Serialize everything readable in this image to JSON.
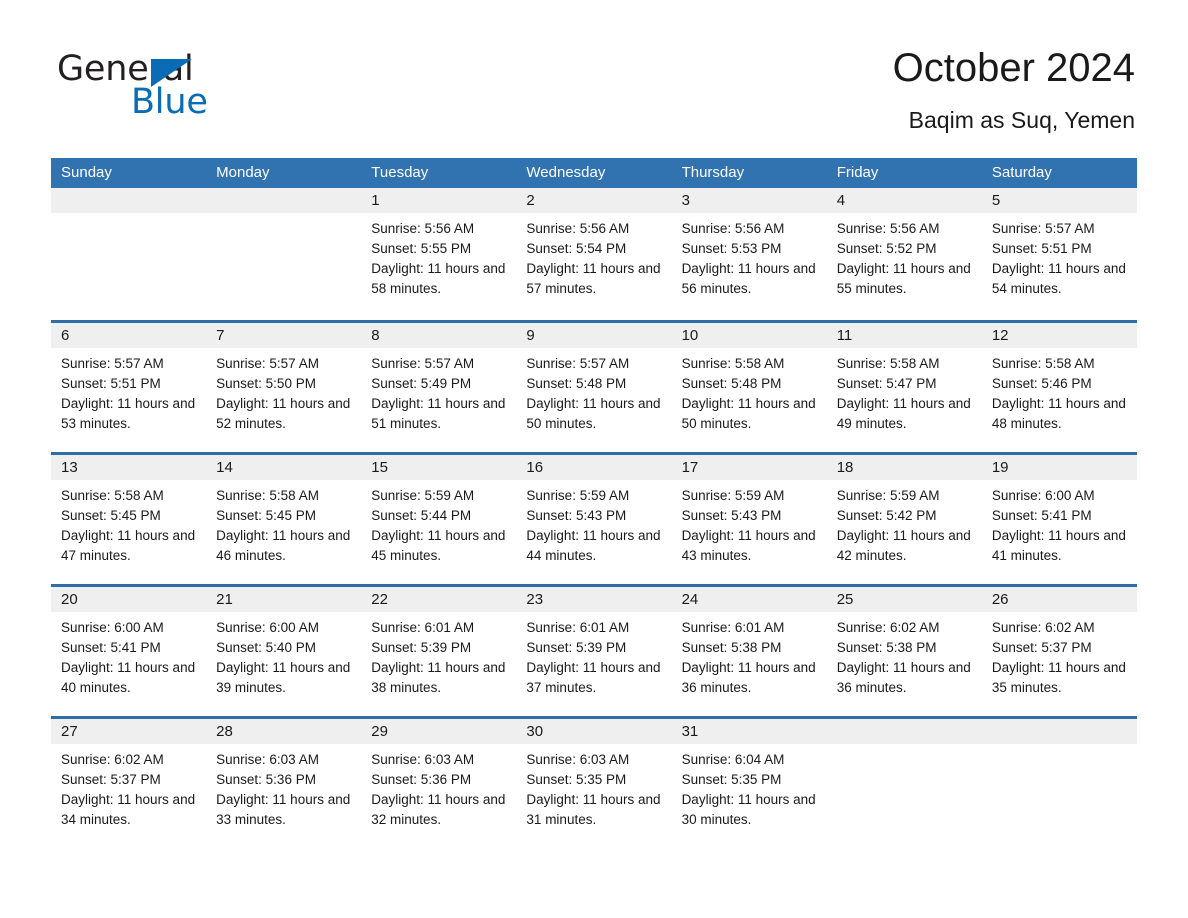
{
  "brand": {
    "word_one": "General",
    "word_two": "Blue",
    "triangle_color": "#0a6cb4",
    "text_color": "#231f20"
  },
  "header": {
    "title": "October 2024",
    "subtitle": "Baqim as Suq, Yemen"
  },
  "theme": {
    "header_blue": "#3172b0",
    "rule_blue": "#2e6da8",
    "date_band": "#efefef",
    "text": "#1a1a1a"
  },
  "weekdays": [
    "Sunday",
    "Monday",
    "Tuesday",
    "Wednesday",
    "Thursday",
    "Friday",
    "Saturday"
  ],
  "weeks": [
    [
      {
        "day": "",
        "sunrise": "",
        "sunset": "",
        "daylight": "",
        "empty": true
      },
      {
        "day": "",
        "sunrise": "",
        "sunset": "",
        "daylight": "",
        "empty": true
      },
      {
        "day": "1",
        "sunrise": "Sunrise: 5:56 AM",
        "sunset": "Sunset: 5:55 PM",
        "daylight": "Daylight: 11 hours and 58 minutes."
      },
      {
        "day": "2",
        "sunrise": "Sunrise: 5:56 AM",
        "sunset": "Sunset: 5:54 PM",
        "daylight": "Daylight: 11 hours and 57 minutes."
      },
      {
        "day": "3",
        "sunrise": "Sunrise: 5:56 AM",
        "sunset": "Sunset: 5:53 PM",
        "daylight": "Daylight: 11 hours and 56 minutes."
      },
      {
        "day": "4",
        "sunrise": "Sunrise: 5:56 AM",
        "sunset": "Sunset: 5:52 PM",
        "daylight": "Daylight: 11 hours and 55 minutes."
      },
      {
        "day": "5",
        "sunrise": "Sunrise: 5:57 AM",
        "sunset": "Sunset: 5:51 PM",
        "daylight": "Daylight: 11 hours and 54 minutes."
      }
    ],
    [
      {
        "day": "6",
        "sunrise": "Sunrise: 5:57 AM",
        "sunset": "Sunset: 5:51 PM",
        "daylight": "Daylight: 11 hours and 53 minutes."
      },
      {
        "day": "7",
        "sunrise": "Sunrise: 5:57 AM",
        "sunset": "Sunset: 5:50 PM",
        "daylight": "Daylight: 11 hours and 52 minutes."
      },
      {
        "day": "8",
        "sunrise": "Sunrise: 5:57 AM",
        "sunset": "Sunset: 5:49 PM",
        "daylight": "Daylight: 11 hours and 51 minutes."
      },
      {
        "day": "9",
        "sunrise": "Sunrise: 5:57 AM",
        "sunset": "Sunset: 5:48 PM",
        "daylight": "Daylight: 11 hours and 50 minutes."
      },
      {
        "day": "10",
        "sunrise": "Sunrise: 5:58 AM",
        "sunset": "Sunset: 5:48 PM",
        "daylight": "Daylight: 11 hours and 50 minutes."
      },
      {
        "day": "11",
        "sunrise": "Sunrise: 5:58 AM",
        "sunset": "Sunset: 5:47 PM",
        "daylight": "Daylight: 11 hours and 49 minutes."
      },
      {
        "day": "12",
        "sunrise": "Sunrise: 5:58 AM",
        "sunset": "Sunset: 5:46 PM",
        "daylight": "Daylight: 11 hours and 48 minutes."
      }
    ],
    [
      {
        "day": "13",
        "sunrise": "Sunrise: 5:58 AM",
        "sunset": "Sunset: 5:45 PM",
        "daylight": "Daylight: 11 hours and 47 minutes."
      },
      {
        "day": "14",
        "sunrise": "Sunrise: 5:58 AM",
        "sunset": "Sunset: 5:45 PM",
        "daylight": "Daylight: 11 hours and 46 minutes."
      },
      {
        "day": "15",
        "sunrise": "Sunrise: 5:59 AM",
        "sunset": "Sunset: 5:44 PM",
        "daylight": "Daylight: 11 hours and 45 minutes."
      },
      {
        "day": "16",
        "sunrise": "Sunrise: 5:59 AM",
        "sunset": "Sunset: 5:43 PM",
        "daylight": "Daylight: 11 hours and 44 minutes."
      },
      {
        "day": "17",
        "sunrise": "Sunrise: 5:59 AM",
        "sunset": "Sunset: 5:43 PM",
        "daylight": "Daylight: 11 hours and 43 minutes."
      },
      {
        "day": "18",
        "sunrise": "Sunrise: 5:59 AM",
        "sunset": "Sunset: 5:42 PM",
        "daylight": "Daylight: 11 hours and 42 minutes."
      },
      {
        "day": "19",
        "sunrise": "Sunrise: 6:00 AM",
        "sunset": "Sunset: 5:41 PM",
        "daylight": "Daylight: 11 hours and 41 minutes."
      }
    ],
    [
      {
        "day": "20",
        "sunrise": "Sunrise: 6:00 AM",
        "sunset": "Sunset: 5:41 PM",
        "daylight": "Daylight: 11 hours and 40 minutes."
      },
      {
        "day": "21",
        "sunrise": "Sunrise: 6:00 AM",
        "sunset": "Sunset: 5:40 PM",
        "daylight": "Daylight: 11 hours and 39 minutes."
      },
      {
        "day": "22",
        "sunrise": "Sunrise: 6:01 AM",
        "sunset": "Sunset: 5:39 PM",
        "daylight": "Daylight: 11 hours and 38 minutes."
      },
      {
        "day": "23",
        "sunrise": "Sunrise: 6:01 AM",
        "sunset": "Sunset: 5:39 PM",
        "daylight": "Daylight: 11 hours and 37 minutes."
      },
      {
        "day": "24",
        "sunrise": "Sunrise: 6:01 AM",
        "sunset": "Sunset: 5:38 PM",
        "daylight": "Daylight: 11 hours and 36 minutes."
      },
      {
        "day": "25",
        "sunrise": "Sunrise: 6:02 AM",
        "sunset": "Sunset: 5:38 PM",
        "daylight": "Daylight: 11 hours and 36 minutes."
      },
      {
        "day": "26",
        "sunrise": "Sunrise: 6:02 AM",
        "sunset": "Sunset: 5:37 PM",
        "daylight": "Daylight: 11 hours and 35 minutes."
      }
    ],
    [
      {
        "day": "27",
        "sunrise": "Sunrise: 6:02 AM",
        "sunset": "Sunset: 5:37 PM",
        "daylight": "Daylight: 11 hours and 34 minutes."
      },
      {
        "day": "28",
        "sunrise": "Sunrise: 6:03 AM",
        "sunset": "Sunset: 5:36 PM",
        "daylight": "Daylight: 11 hours and 33 minutes."
      },
      {
        "day": "29",
        "sunrise": "Sunrise: 6:03 AM",
        "sunset": "Sunset: 5:36 PM",
        "daylight": "Daylight: 11 hours and 32 minutes."
      },
      {
        "day": "30",
        "sunrise": "Sunrise: 6:03 AM",
        "sunset": "Sunset: 5:35 PM",
        "daylight": "Daylight: 11 hours and 31 minutes."
      },
      {
        "day": "31",
        "sunrise": "Sunrise: 6:04 AM",
        "sunset": "Sunset: 5:35 PM",
        "daylight": "Daylight: 11 hours and 30 minutes."
      },
      {
        "day": "",
        "sunrise": "",
        "sunset": "",
        "daylight": "",
        "empty": true
      },
      {
        "day": "",
        "sunrise": "",
        "sunset": "",
        "daylight": "",
        "empty": true
      }
    ]
  ]
}
